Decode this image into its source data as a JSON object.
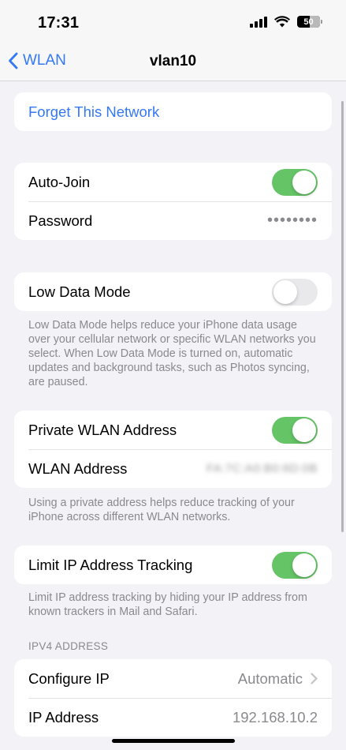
{
  "status_bar": {
    "time": "17:31",
    "battery": "50",
    "icons": [
      "cellular-signal-icon",
      "wifi-icon",
      "battery-icon"
    ]
  },
  "nav": {
    "back_label": "WLAN",
    "title": "vlan10"
  },
  "forget": {
    "label": "Forget This Network"
  },
  "join": {
    "auto_join_label": "Auto-Join",
    "auto_join_on": true,
    "password_label": "Password",
    "password_value": "••••••••"
  },
  "low_data": {
    "label": "Low Data Mode",
    "on": false,
    "footnote": "Low Data Mode helps reduce your iPhone data usage over your cellular network or specific WLAN networks you select. When Low Data Mode is turned on, automatic updates and background tasks, such as Photos syncing, are paused."
  },
  "private": {
    "label": "Private WLAN Address",
    "on": true,
    "address_label": "WLAN Address",
    "address_value": "FA:7C:A0:B0:6D:0B",
    "footnote": "Using a private address helps reduce tracking of your iPhone across different WLAN networks."
  },
  "limit_ip": {
    "label": "Limit IP Address Tracking",
    "on": true,
    "footnote": "Limit IP address tracking by hiding your IP address from known trackers in Mail and Safari."
  },
  "ipv4": {
    "header": "IPV4 ADDRESS",
    "configure_label": "Configure IP",
    "configure_value": "Automatic",
    "ip_label": "IP Address",
    "ip_value": "192.168.10.2"
  },
  "colors": {
    "accent": "#3478f6",
    "toggle_on": "#65c466",
    "background": "#f2f2f7"
  }
}
